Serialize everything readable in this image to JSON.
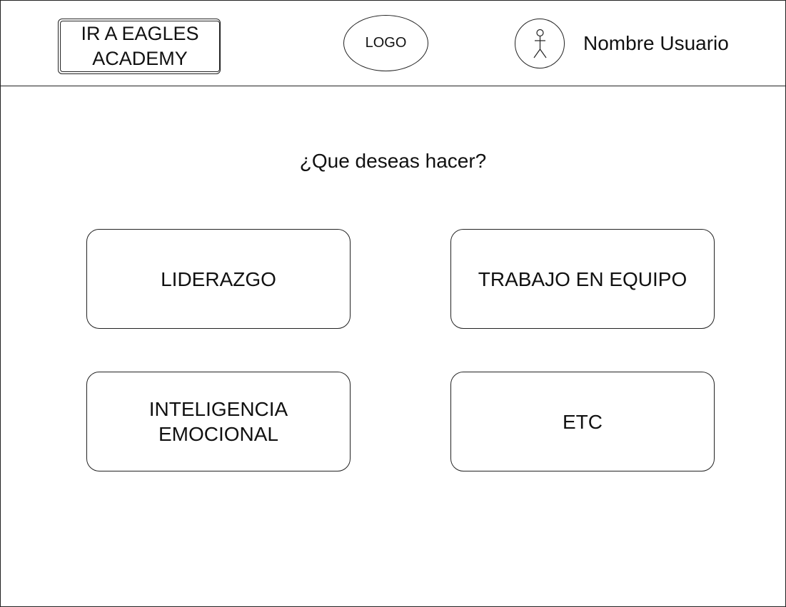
{
  "header": {
    "eagles_button_label": "IR A EAGLES\nACADEMY",
    "logo_text": "LOGO",
    "avatar_icon": "user-stick-figure-icon",
    "username": "Nombre Usuario"
  },
  "main": {
    "question": "¿Que deseas hacer?",
    "options": [
      {
        "label": "LIDERAZGO"
      },
      {
        "label": "TRABAJO EN EQUIPO"
      },
      {
        "label": "INTELIGENCIA\nEMOCIONAL"
      },
      {
        "label": "ETC"
      }
    ]
  }
}
